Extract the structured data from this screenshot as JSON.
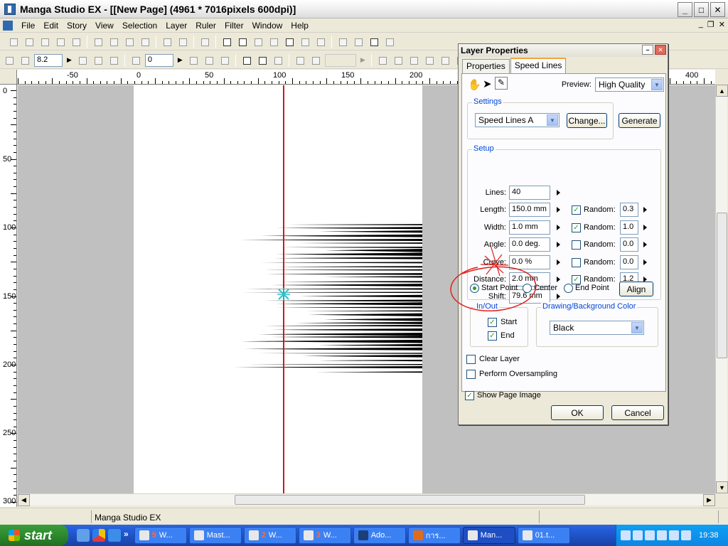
{
  "window": {
    "title": "Manga Studio EX - [[New Page] (4961 * 7016pixels 600dpi)]",
    "min": "_",
    "max": "□",
    "close": "✕"
  },
  "menu": [
    "File",
    "Edit",
    "Story",
    "View",
    "Selection",
    "Layer",
    "Ruler",
    "Filter",
    "Window",
    "Help"
  ],
  "toolbar2": {
    "zoom_value": "8.2",
    "rotation_value": "0"
  },
  "ruler": {
    "h_labels": [
      "-50",
      "0",
      "50",
      "100",
      "150",
      "200",
      "400"
    ],
    "v_labels": [
      "0",
      "50",
      "100",
      "150",
      "200",
      "250",
      "300"
    ]
  },
  "status": {
    "text": "Manga Studio EX"
  },
  "dialog": {
    "title": "Layer Properties",
    "tabs": [
      "Properties",
      "Speed Lines"
    ],
    "preview_label": "Preview:",
    "preview_value": "High Quality",
    "settings_group": "Settings",
    "settings_value": "Speed Lines A",
    "change_button": "Change...",
    "generate_button": "Generate",
    "setup_group": "Setup",
    "setup_rows": [
      {
        "label": "Lines:",
        "value": "40"
      },
      {
        "label": "Length:",
        "value": "150.0 mm",
        "random": true,
        "random_value": "0.3"
      },
      {
        "label": "Width:",
        "value": "1.0 mm",
        "random": true,
        "random_value": "1.0"
      },
      {
        "label": "Angle:",
        "value": "0.0 deg.",
        "random": false,
        "random_value": "0.0"
      },
      {
        "label": "Curve:",
        "value": "0.0 %",
        "random": false,
        "random_value": "0.0"
      },
      {
        "label": "Distance:",
        "value": "2.0 mm",
        "random": true,
        "random_value": "1.2"
      },
      {
        "label": "Shift:",
        "value": "79.6 mm"
      }
    ],
    "random_label": "Random:",
    "origin_options": [
      "Start Point",
      "Center",
      "End Point"
    ],
    "origin_selected": "Start Point",
    "align_button": "Align",
    "inout_group": "In/Out",
    "inout_start": "Start",
    "inout_end": "End",
    "color_group": "Drawing/Background Color",
    "color_value": "Black",
    "clear_layer": "Clear Layer",
    "oversampling": "Perform Oversampling",
    "show_page_image": "Show Page Image",
    "ok_button": "OK",
    "cancel_button": "Cancel"
  },
  "taskbar": {
    "start": "start",
    "tasks": [
      {
        "count": "5",
        "label": "W..."
      },
      {
        "label": "Mast..."
      },
      {
        "count": "2",
        "label": "W..."
      },
      {
        "count": "3",
        "label": "W..."
      },
      {
        "label": "Ado..."
      },
      {
        "label": "การ..."
      },
      {
        "label": "Man...",
        "active": true
      },
      {
        "label": "01.t..."
      }
    ],
    "overflow": "»",
    "clock": "19:38"
  },
  "colors": {
    "guide_line": "#cc1a1a",
    "origin_marker": "#22c8d2",
    "annotation": "#e0201c"
  }
}
